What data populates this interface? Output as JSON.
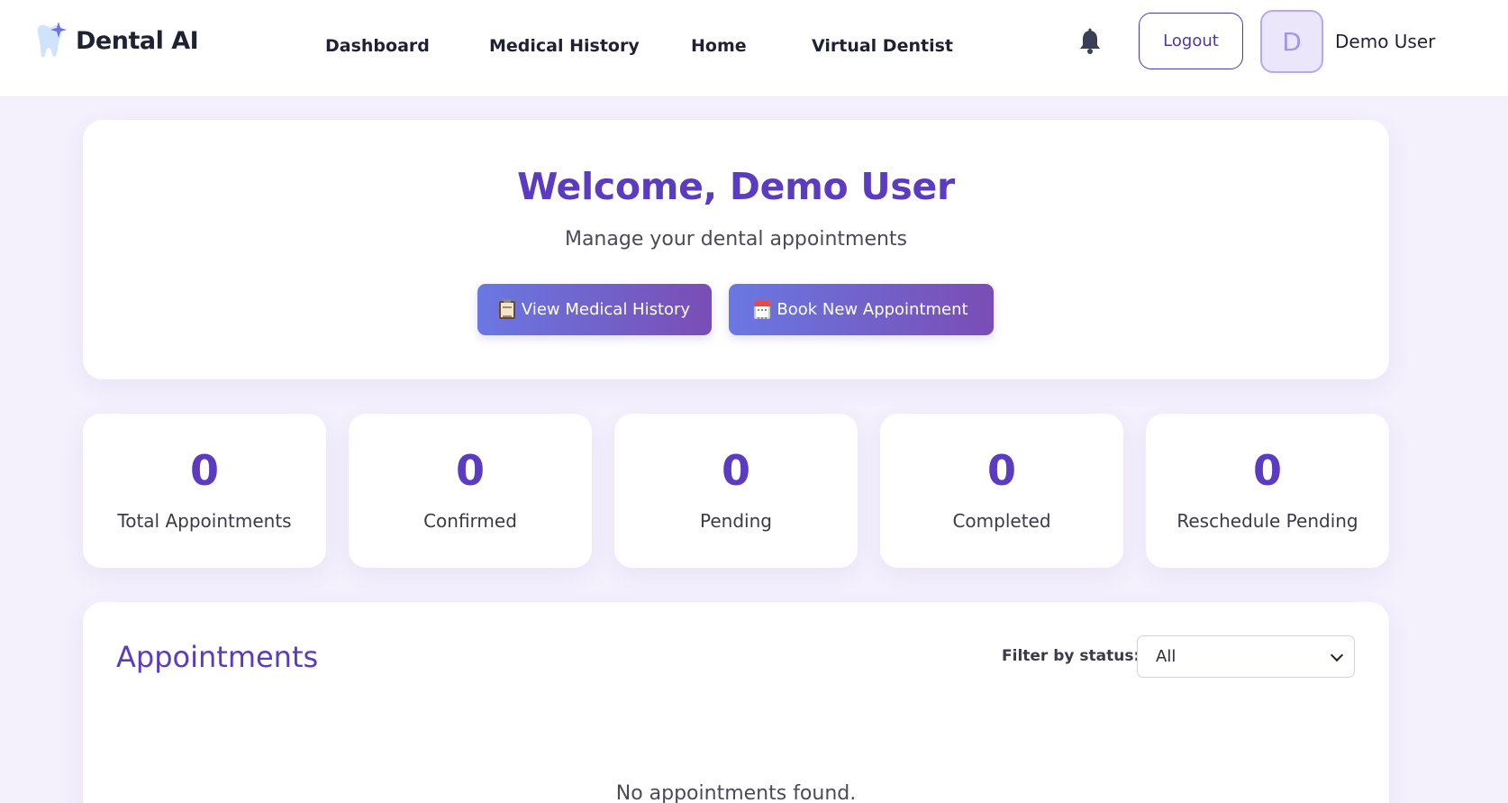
{
  "brand": {
    "name": "Dental AI",
    "icon": "tooth-sparkle-icon"
  },
  "nav": {
    "items": [
      {
        "label": "Dashboard"
      },
      {
        "label": "Medical History"
      },
      {
        "label": "Home"
      },
      {
        "label": "Virtual Dentist"
      }
    ]
  },
  "header": {
    "notification_icon": "bell-icon",
    "logout_label": "Logout",
    "avatar_initial": "D",
    "user_name": "Demo User"
  },
  "welcome": {
    "title": "Welcome, Demo User",
    "subtitle": "Manage your dental appointments",
    "view_history_label": "View Medical History",
    "view_history_icon": "clipboard-icon",
    "book_label": "Book New Appointment",
    "book_icon": "calendar-icon"
  },
  "stats": [
    {
      "value": "0",
      "label": "Total Appointments"
    },
    {
      "value": "0",
      "label": "Confirmed"
    },
    {
      "value": "0",
      "label": "Pending"
    },
    {
      "value": "0",
      "label": "Completed"
    },
    {
      "value": "0",
      "label": "Reschedule Pending"
    }
  ],
  "appointments": {
    "title": "Appointments",
    "filter_label": "Filter by status:",
    "filter_value": "All",
    "empty_message": "No appointments found."
  },
  "colors": {
    "accent": "#5b3bbf",
    "button_gradient_start": "#6a78e2",
    "button_gradient_end": "#7a4db5",
    "background": "#f4f0fc"
  }
}
